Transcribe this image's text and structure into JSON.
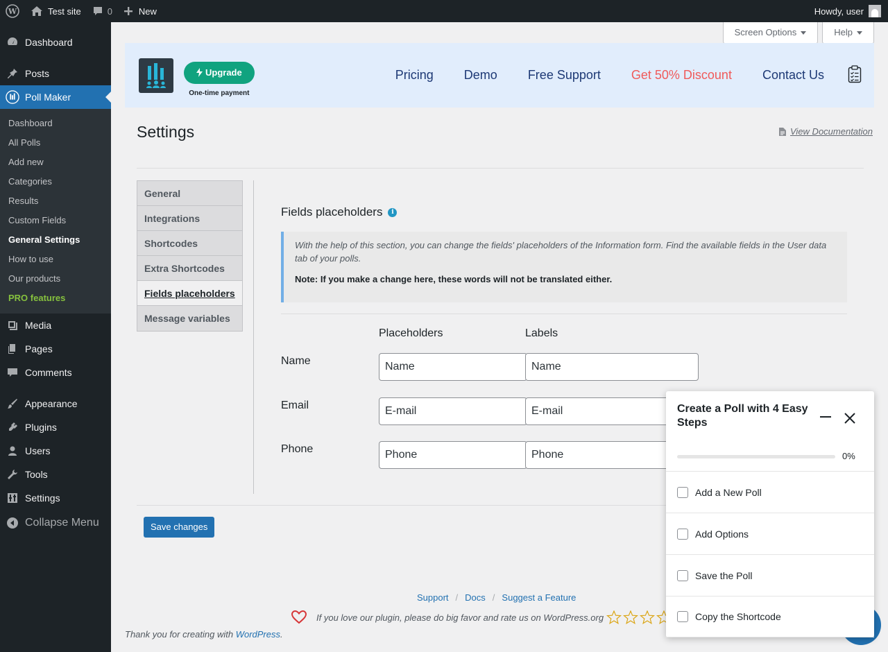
{
  "adminbar": {
    "site_name": "Test site",
    "comments_count": "0",
    "new_label": "New",
    "howdy": "Howdy, user"
  },
  "sidebar": {
    "items_top": [
      {
        "label": "Dashboard",
        "icon": "dashboard-icon"
      },
      {
        "label": "Posts",
        "icon": "pin-icon"
      },
      {
        "label": "Poll Maker",
        "icon": "poll-icon"
      }
    ],
    "submenu": [
      "Dashboard",
      "All Polls",
      "Add new",
      "Categories",
      "Results",
      "Custom Fields",
      "General Settings",
      "How to use",
      "Our products",
      "PRO features"
    ],
    "items_bottom": [
      {
        "label": "Media",
        "icon": "media-icon"
      },
      {
        "label": "Pages",
        "icon": "pages-icon"
      },
      {
        "label": "Comments",
        "icon": "comment-icon"
      },
      {
        "label": "Appearance",
        "icon": "brush-icon"
      },
      {
        "label": "Plugins",
        "icon": "plug-icon"
      },
      {
        "label": "Users",
        "icon": "user-icon"
      },
      {
        "label": "Tools",
        "icon": "wrench-icon"
      },
      {
        "label": "Settings",
        "icon": "sliders-icon"
      }
    ],
    "collapse": "Collapse Menu"
  },
  "screen_options": "Screen Options",
  "help": "Help",
  "plugin_header": {
    "upgrade": "Upgrade",
    "upgrade_sub": "One-time payment",
    "nav": [
      "Pricing",
      "Demo",
      "Free Support",
      "Get 50% Discount",
      "Contact Us"
    ],
    "discount_color": "#f05a5a"
  },
  "page": {
    "title": "Settings",
    "view_doc": "View Documentation"
  },
  "tabs": [
    "General",
    "Integrations",
    "Shortcodes",
    "Extra Shortcodes",
    "Fields placeholders",
    "Message variables"
  ],
  "section": {
    "title": "Fields placeholders",
    "notice_text": "With the help of this section, you can change the fields' placeholders of the Information form. Find the available fields in the User data tab of your polls.",
    "notice_note": "Note: If you make a change here, these words will not be translated either.",
    "col_placeholders": "Placeholders",
    "col_labels": "Labels",
    "rows": [
      {
        "label": "Name",
        "placeholder": "Name",
        "field_label": "Name"
      },
      {
        "label": "Email",
        "placeholder": "E-mail",
        "field_label": "E-mail"
      },
      {
        "label": "Phone",
        "placeholder": "Phone",
        "field_label": "Phone"
      }
    ]
  },
  "save": "Save changes",
  "footer": {
    "support": "Support",
    "docs": "Docs",
    "suggest": "Suggest a Feature",
    "rate": "If you love our plugin, please do big favor and rate us on WordPress.org",
    "thanks_prefix": "Thank you for creating with ",
    "thanks_link": "WordPress",
    "thanks_suffix": "."
  },
  "widget": {
    "title": "Create a Poll with 4 Easy Steps",
    "progress_pct": "0%",
    "progress_value": 0,
    "steps": [
      "Add a New Poll",
      "Add Options",
      "Save the Poll",
      "Copy the Shortcode"
    ]
  }
}
